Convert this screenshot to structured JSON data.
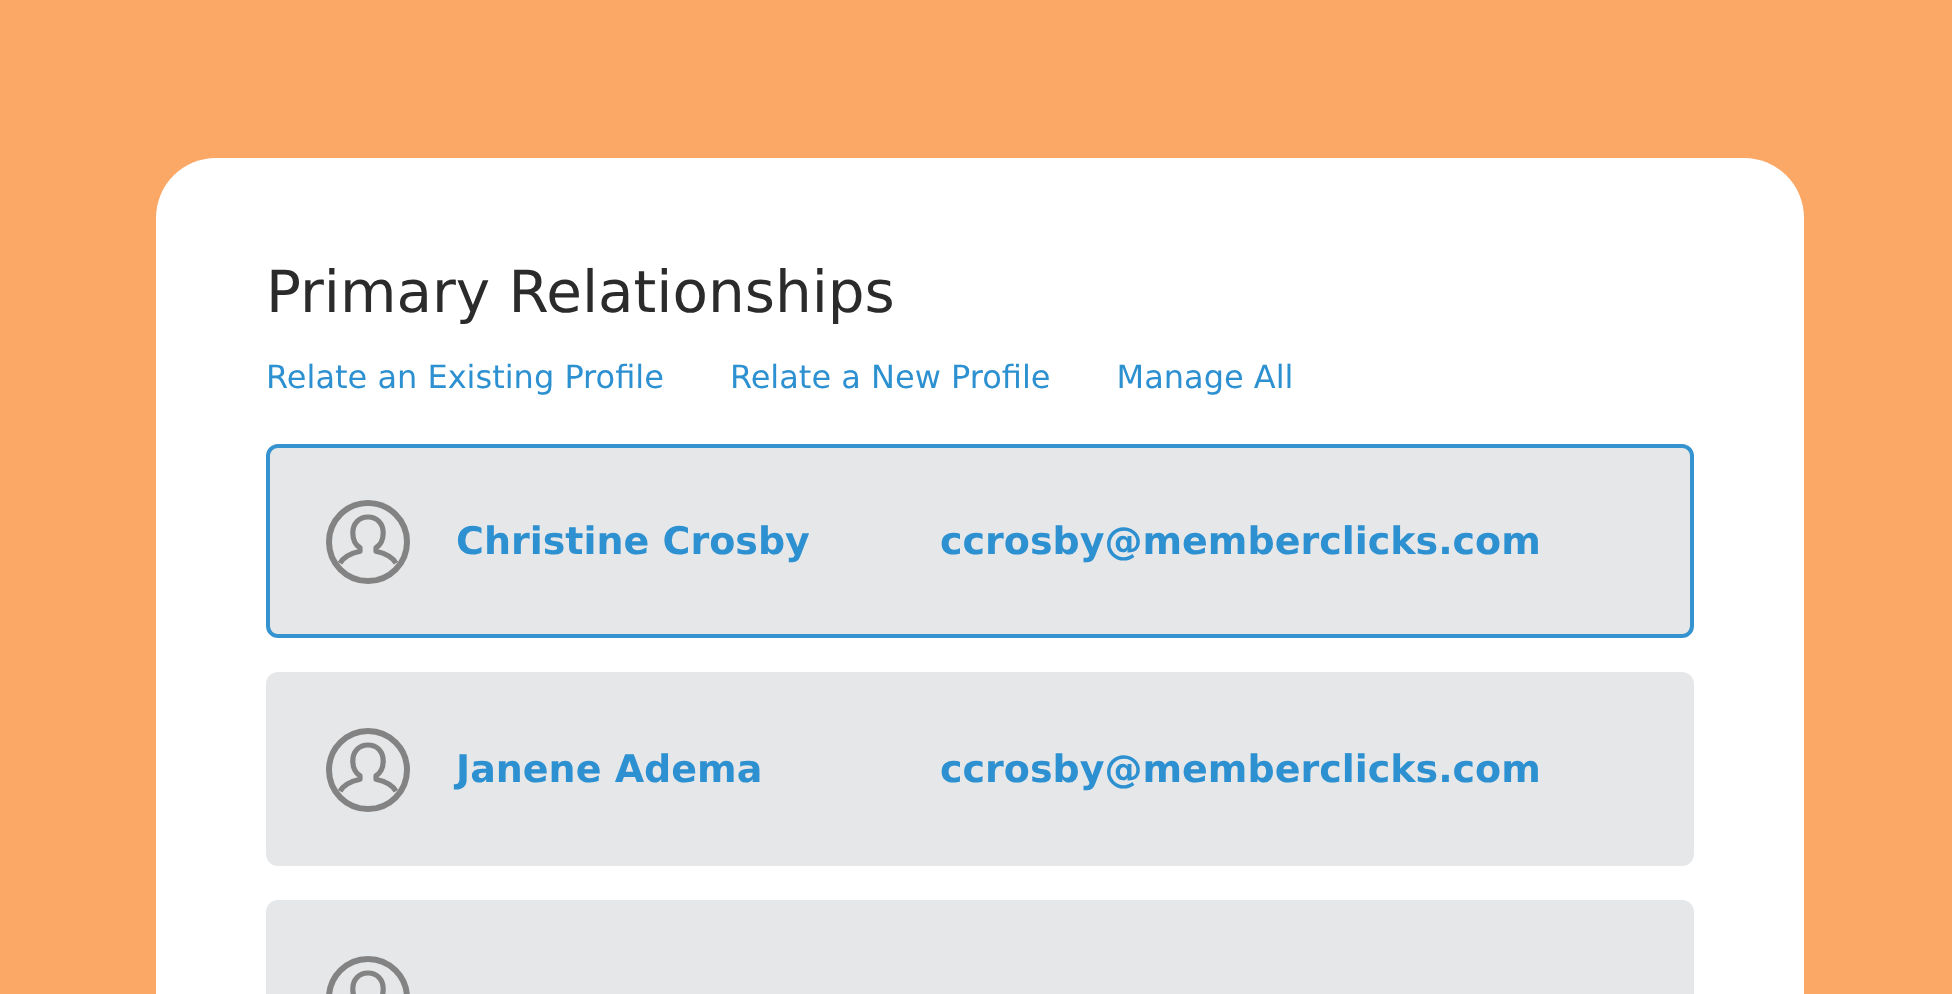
{
  "title": "Primary Relationships",
  "links": [
    "Relate an Existing Profile",
    "Relate a New Profile",
    "Manage All"
  ],
  "rows": [
    {
      "name": "Christine Crosby",
      "email": "ccrosby@memberclicks.com",
      "selected": true
    },
    {
      "name": "Janene Adema",
      "email": "ccrosby@memberclicks.com",
      "selected": false
    },
    {
      "selected": false
    }
  ]
}
